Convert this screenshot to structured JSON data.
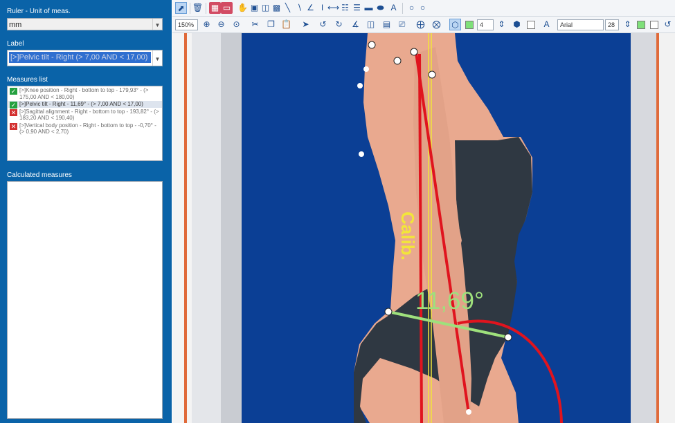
{
  "left_panel": {
    "ruler_label": "Ruler - Unit of meas.",
    "unit_value": "mm",
    "label_heading": "Label",
    "label_value": "[>]Pelvic tilt - Right (> 7,00 AND < 17,00)",
    "measures_heading": "Measures list",
    "measures": [
      {
        "status": "ok",
        "text": "[>]Knee position - Right - bottom to top - 179,93° - (> 175,00 AND < 180,00)"
      },
      {
        "status": "ok",
        "text": "[>]Pelvic tilt - Right - 11,69° - (> 7,00 AND < 17,00)",
        "selected": true
      },
      {
        "status": "ko",
        "text": "[>]Sagittal alignment - Right - bottom to top - 193,82° - (> 183,20 AND < 190,40)"
      },
      {
        "status": "ko",
        "text": "[>]Vertical body position - Right - bottom to top - -0,70° - (> 0,90 AND < 2,70)"
      }
    ],
    "calculated_heading": "Calculated measures"
  },
  "toolbar2": {
    "zoom": "150%",
    "line_width": "4",
    "font_name": "Arial",
    "font_size": "28"
  },
  "canvas": {
    "angle_label": "11,69°",
    "vertical_text": "Calib."
  },
  "colors": {
    "panel_bg": "#0a63a8",
    "backdrop_blue": "#0b3f95",
    "measure_red": "#e0141e",
    "measure_green": "#9ee07c",
    "calib_yellow": "#f2e53a"
  },
  "icons": [
    "pointer-icon",
    "trash-icon",
    "pan-hand-icon",
    "zoom-in-icon",
    "zoom-out-icon",
    "cut-icon",
    "copy-icon",
    "paste-icon",
    "crop-icon",
    "polygon-icon",
    "text-icon",
    "font-size-icon"
  ]
}
